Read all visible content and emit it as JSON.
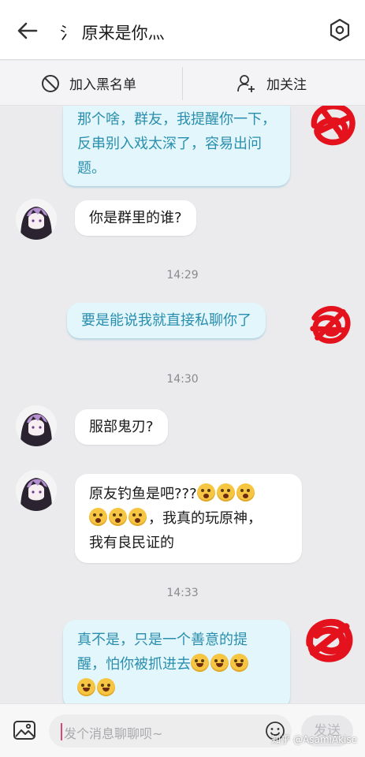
{
  "header": {
    "title": "氵 原来是你灬"
  },
  "actions": {
    "block_label": "加入黑名单",
    "follow_label": "加关注"
  },
  "messages": [
    {
      "from": "me",
      "text": "那个啥，群友，我提醒你一下，反串别入戏太深了，容易出问题。"
    },
    {
      "from": "them",
      "text": "你是群里的谁?"
    },
    {
      "from": "me",
      "text": "要是能说我就直接私聊你了"
    },
    {
      "from": "them",
      "text": "服部鬼刃?"
    },
    {
      "from": "them",
      "text": "原友钓鱼是吧??? 😱😱😱😱😱😱，我真的玩原神，我有良民证的",
      "line1": "原友钓鱼是吧???",
      "line2": "，我真的玩原神，",
      "line3": "我有良民证的"
    },
    {
      "from": "me",
      "text": "真不是，只是一个善意的提醒，怕你被抓进去😅😅😅😅😅",
      "line1": "真不是，只是一个善意的提",
      "line2": "醒，怕你被抓进去"
    }
  ],
  "timestamps": [
    "14:29",
    "14:30",
    "14:33"
  ],
  "composer": {
    "placeholder": "发个消息聊聊呗~",
    "send_label": "发送"
  },
  "watermark": "知乎 @AsamiAkise",
  "colors": {
    "outgoing_bubble": "#e2f6fb",
    "outgoing_text": "#2a8fae",
    "incoming_bubble": "#ffffff",
    "scribble": "#e3121c"
  }
}
